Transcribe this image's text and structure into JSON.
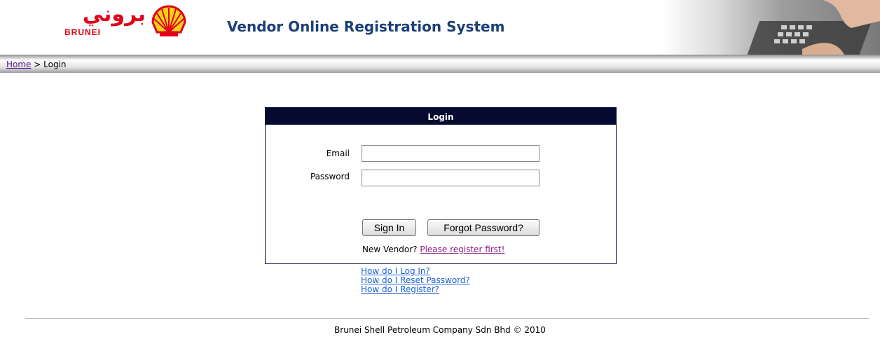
{
  "header": {
    "logo_arabic": "بروني",
    "logo_brunei": "BRUNEI",
    "title": "Vendor Online Registration System"
  },
  "breadcrumb": {
    "home": "Home",
    "separator": " > ",
    "current": "Login"
  },
  "login": {
    "heading": "Login",
    "email_label": "Email",
    "email_value": "",
    "password_label": "Password",
    "password_value": "",
    "sign_in": "Sign In",
    "forgot": "Forgot Password?",
    "new_vendor": "New Vendor? ",
    "register_link": "Please register first!"
  },
  "help_links": [
    "How do I Log In?",
    "How do I Reset Password?",
    "How do I Register?"
  ],
  "footer": "Brunei Shell Petroleum Company Sdn Bhd © 2010",
  "colors": {
    "shell_red": "#e2001a",
    "shell_yellow": "#f7d117",
    "title_blue": "#1c3f77",
    "login_header": "#070a30",
    "link_blue": "#1a5fd6",
    "visited_link": "#8b1d8b"
  }
}
